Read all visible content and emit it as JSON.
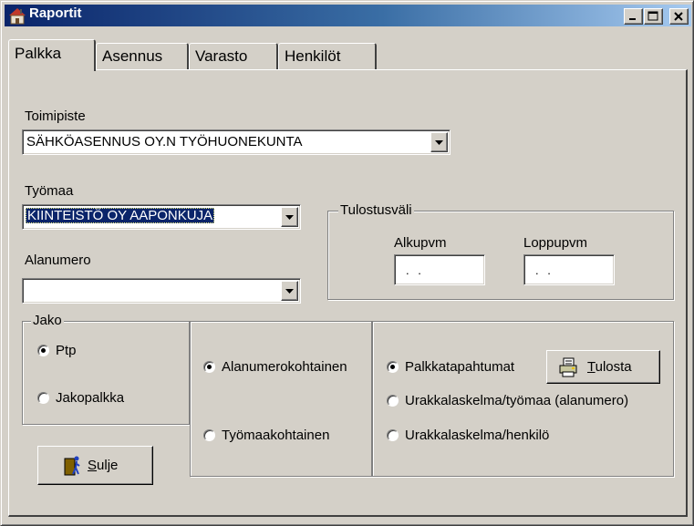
{
  "window": {
    "title": "Raportit",
    "app_icon": "house-icon",
    "minimize_icon": "minimize-icon",
    "maximize_icon": "maximize-icon",
    "close_icon": "close-icon"
  },
  "tabs": [
    {
      "label": "Palkka",
      "active": true
    },
    {
      "label": "Asennus",
      "active": false
    },
    {
      "label": "Varasto",
      "active": false
    },
    {
      "label": "Henkilöt",
      "active": false
    }
  ],
  "toimipiste": {
    "label": "Toimipiste",
    "value": "SÄHKÖASENNUS OY.N TYÖHUONEKUNTA"
  },
  "tyomaa": {
    "label": "Työmaa",
    "value": "KIINTEISTÖ OY AAPONKUJA"
  },
  "alanumero": {
    "label": "Alanumero",
    "value": ""
  },
  "tulostusvali": {
    "title": "Tulostusväli",
    "alkupvm_label": "Alkupvm",
    "alkupvm_value": ". .",
    "loppupvm_label": "Loppupvm",
    "loppupvm_value": ". ."
  },
  "jako": {
    "title": "Jako",
    "options": [
      {
        "label": "Ptp",
        "checked": true
      },
      {
        "label": "Jakopalkka",
        "checked": false
      }
    ]
  },
  "kohtainen": {
    "options": [
      {
        "label": "Alanumerokohtainen",
        "checked": true
      },
      {
        "label": "Työmaakohtainen",
        "checked": false
      }
    ]
  },
  "raportti": {
    "options": [
      {
        "label": "Palkkatapahtumat",
        "checked": true
      },
      {
        "label": "Urakkalaskelma/työmaa (alanumero)",
        "checked": false
      },
      {
        "label": "Urakkalaskelma/henkilö",
        "checked": false
      }
    ]
  },
  "buttons": {
    "tulosta_label": "Tulosta",
    "tulosta_accel": "T",
    "tulosta_rest": "ulosta",
    "tulosta_icon": "printer-icon",
    "sulje_label": "Sulje",
    "sulje_accel": "S",
    "sulje_rest": "ulje",
    "sulje_icon": "exit-door-icon"
  },
  "colors": {
    "face": "#d4d0c8",
    "titlebar": "#0a246a",
    "selection": "#0a246a"
  }
}
